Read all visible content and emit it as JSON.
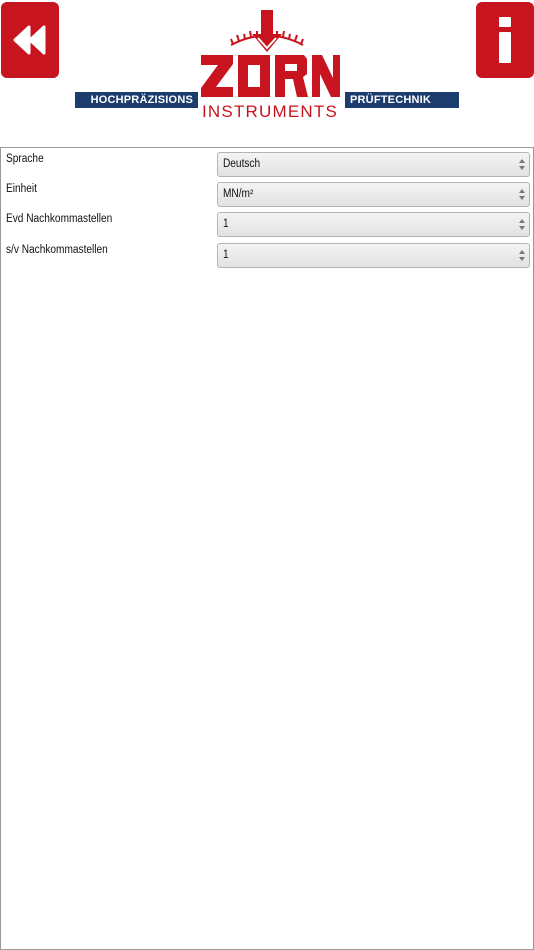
{
  "header": {
    "back_icon": "double-chevron-left-icon",
    "info_icon": "info-icon",
    "brand_color": "#c8141e",
    "band_color": "#1c3c6e",
    "logo": {
      "wordmark": "ZORN",
      "tagline_left": "HOCHPRÄZISIONS",
      "tagline_right": "PRÜFTECHNIK",
      "subtitle": "INSTRUMENTS"
    }
  },
  "settings": [
    {
      "label": "Sprache",
      "value": "Deutsch"
    },
    {
      "label": "Einheit",
      "value": "MN/m²"
    },
    {
      "label": "Evd Nachkommastellen",
      "value": "1"
    },
    {
      "label": "s/v Nachkommastellen",
      "value": "1"
    }
  ]
}
